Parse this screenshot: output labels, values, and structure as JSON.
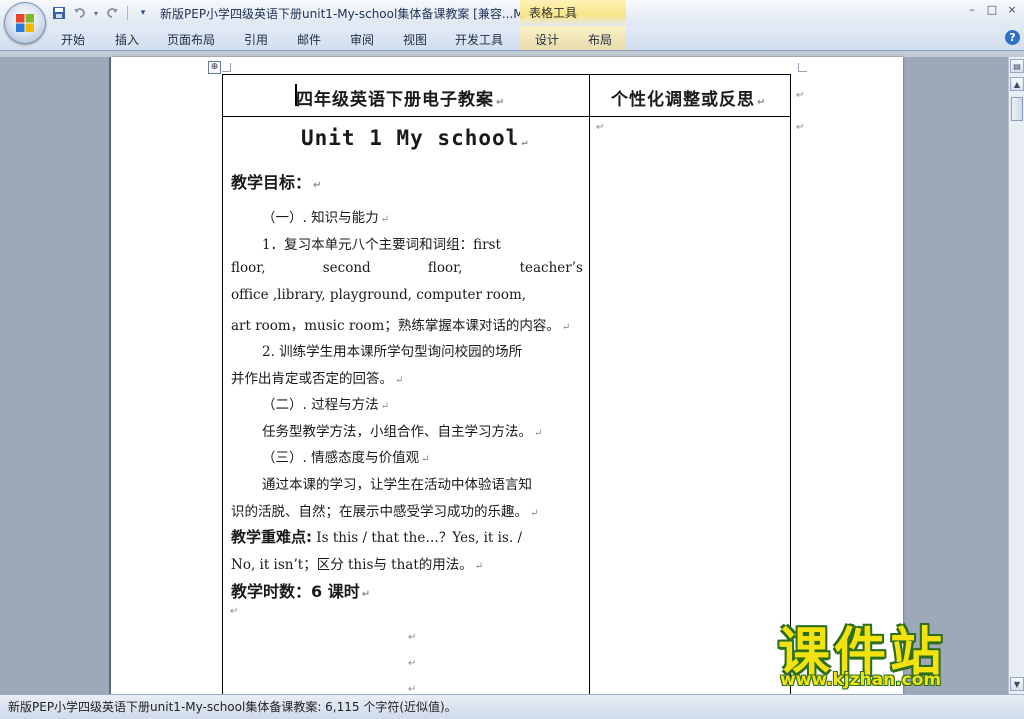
{
  "window": {
    "title": "新版PEP小学四级英语下册unit1-My-school集体备课教案 [兼容...M",
    "contextual_tab_group": "表格工具",
    "controls": [
      "–",
      "□",
      "×"
    ]
  },
  "quick_access": {
    "icons": [
      "save-icon",
      "undo-icon",
      "redo-icon",
      "customize-icon"
    ]
  },
  "ribbon": {
    "tabs": [
      "开始",
      "插入",
      "页面布局",
      "引用",
      "邮件",
      "审阅",
      "视图",
      "开发工具",
      "设计",
      "布局"
    ],
    "help": "?"
  },
  "document": {
    "table_handle": "⊕",
    "header": {
      "col1": "四年级英语下册电子教案",
      "col2": "个性化调整或反思"
    },
    "content": {
      "unit_title": "Unit 1 My school",
      "objectives_heading": "教学目标：",
      "sec1_heading": "（一）. 知识与能力",
      "item1_line1": "1．复习本单元八个主要词和词组：first",
      "item1_line2_words": [
        "floor,",
        "second",
        "floor,",
        "teacher’s"
      ],
      "item1_line3": "office ,library, playground, computer room,",
      "item1_line4": "art room，music room；熟练掌握本课对话的内容。",
      "item2_line1": "2. 训练学生用本课所学句型询问校园的场所",
      "item2_line2": "并作出肯定或否定的回答。",
      "sec2_heading": "（二）. 过程与方法",
      "sec2_body": "任务型教学方法，小组合作、自主学习方法。",
      "sec3_heading": "（三）. 情感态度与价值观",
      "sec3_line1": "通过本课的学习，让学生在活动中体验语言知",
      "sec3_line2": "识的活脱、自然；在展示中感受学习成功的乐趣。",
      "key_points_label": "教学重难点:",
      "key_points_line1": "Is this / that the…？Yes, it is. /",
      "key_points_line2": "No, it isn’t；区分 this与 that的用法。",
      "hours_label": "教学时数：6 课时"
    },
    "paragraph_mark": "↵"
  },
  "status": {
    "text": "新版PEP小学四级英语下册unit1-My-school集体备课教案: 6,115 个字符(近似值)。"
  },
  "watermark": {
    "big": "课件站",
    "url": "www.kjzhan.com"
  },
  "colors": {
    "ribbon_bg": "#d3deee",
    "contextual_tab": "#f6e48a",
    "watermark_fill": "#f3e20f",
    "watermark_stroke": "#2c6e1e"
  }
}
